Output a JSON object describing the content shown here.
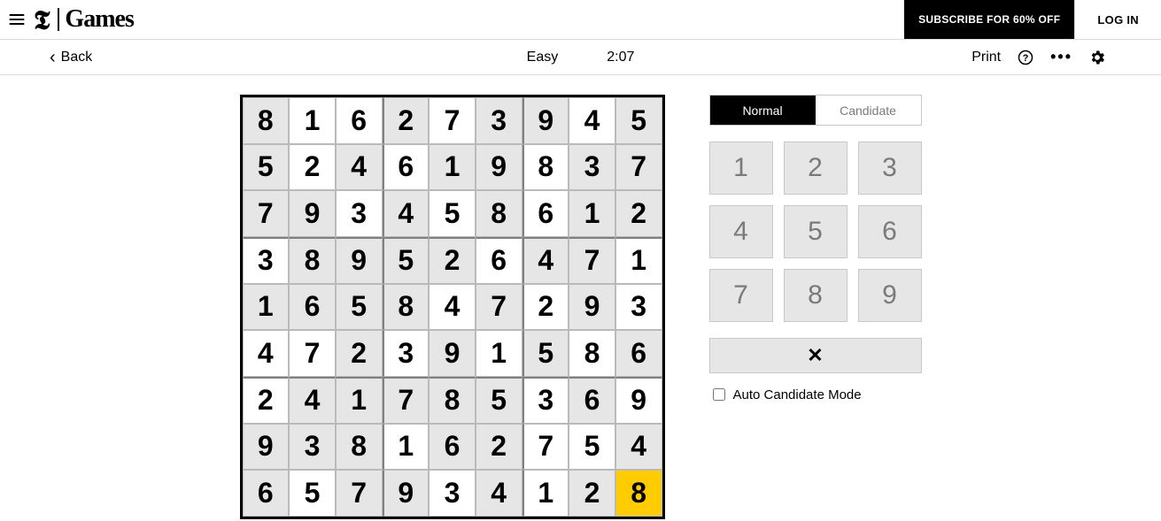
{
  "header": {
    "logo_text": "Games",
    "subscribe_label": "SUBSCRIBE FOR 60% OFF",
    "login_label": "LOG IN"
  },
  "toolbar": {
    "back_label": "Back",
    "difficulty": "Easy",
    "timer": "2:07",
    "print_label": "Print"
  },
  "modes": {
    "normal": "Normal",
    "candidate": "Candidate"
  },
  "keypad": [
    "1",
    "2",
    "3",
    "4",
    "5",
    "6",
    "7",
    "8",
    "9"
  ],
  "erase_symbol": "✕",
  "auto_label": "Auto Candidate Mode",
  "sudoku": {
    "selected": [
      8,
      8
    ],
    "grid": [
      [
        {
          "v": "8",
          "g": true
        },
        {
          "v": "1",
          "g": false
        },
        {
          "v": "6",
          "g": false
        },
        {
          "v": "2",
          "g": true
        },
        {
          "v": "7",
          "g": false
        },
        {
          "v": "3",
          "g": true
        },
        {
          "v": "9",
          "g": true
        },
        {
          "v": "4",
          "g": false
        },
        {
          "v": "5",
          "g": true
        }
      ],
      [
        {
          "v": "5",
          "g": true
        },
        {
          "v": "2",
          "g": false
        },
        {
          "v": "4",
          "g": true
        },
        {
          "v": "6",
          "g": false
        },
        {
          "v": "1",
          "g": true
        },
        {
          "v": "9",
          "g": true
        },
        {
          "v": "8",
          "g": false
        },
        {
          "v": "3",
          "g": true
        },
        {
          "v": "7",
          "g": true
        }
      ],
      [
        {
          "v": "7",
          "g": true
        },
        {
          "v": "9",
          "g": true
        },
        {
          "v": "3",
          "g": false
        },
        {
          "v": "4",
          "g": true
        },
        {
          "v": "5",
          "g": false
        },
        {
          "v": "8",
          "g": true
        },
        {
          "v": "6",
          "g": false
        },
        {
          "v": "1",
          "g": true
        },
        {
          "v": "2",
          "g": true
        }
      ],
      [
        {
          "v": "3",
          "g": false
        },
        {
          "v": "8",
          "g": true
        },
        {
          "v": "9",
          "g": true
        },
        {
          "v": "5",
          "g": true
        },
        {
          "v": "2",
          "g": true
        },
        {
          "v": "6",
          "g": false
        },
        {
          "v": "4",
          "g": true
        },
        {
          "v": "7",
          "g": true
        },
        {
          "v": "1",
          "g": false
        }
      ],
      [
        {
          "v": "1",
          "g": true
        },
        {
          "v": "6",
          "g": true
        },
        {
          "v": "5",
          "g": true
        },
        {
          "v": "8",
          "g": true
        },
        {
          "v": "4",
          "g": false
        },
        {
          "v": "7",
          "g": true
        },
        {
          "v": "2",
          "g": false
        },
        {
          "v": "9",
          "g": true
        },
        {
          "v": "3",
          "g": false
        }
      ],
      [
        {
          "v": "4",
          "g": false
        },
        {
          "v": "7",
          "g": false
        },
        {
          "v": "2",
          "g": true
        },
        {
          "v": "3",
          "g": false
        },
        {
          "v": "9",
          "g": true
        },
        {
          "v": "1",
          "g": false
        },
        {
          "v": "5",
          "g": true
        },
        {
          "v": "8",
          "g": false
        },
        {
          "v": "6",
          "g": true
        }
      ],
      [
        {
          "v": "2",
          "g": false
        },
        {
          "v": "4",
          "g": true
        },
        {
          "v": "1",
          "g": true
        },
        {
          "v": "7",
          "g": true
        },
        {
          "v": "8",
          "g": true
        },
        {
          "v": "5",
          "g": true
        },
        {
          "v": "3",
          "g": false
        },
        {
          "v": "6",
          "g": true
        },
        {
          "v": "9",
          "g": false
        }
      ],
      [
        {
          "v": "9",
          "g": true
        },
        {
          "v": "3",
          "g": true
        },
        {
          "v": "8",
          "g": true
        },
        {
          "v": "1",
          "g": false
        },
        {
          "v": "6",
          "g": true
        },
        {
          "v": "2",
          "g": true
        },
        {
          "v": "7",
          "g": false
        },
        {
          "v": "5",
          "g": false
        },
        {
          "v": "4",
          "g": true
        }
      ],
      [
        {
          "v": "6",
          "g": true
        },
        {
          "v": "5",
          "g": false
        },
        {
          "v": "7",
          "g": true
        },
        {
          "v": "9",
          "g": true
        },
        {
          "v": "3",
          "g": false
        },
        {
          "v": "4",
          "g": true
        },
        {
          "v": "1",
          "g": false
        },
        {
          "v": "2",
          "g": true
        },
        {
          "v": "8",
          "g": false
        }
      ]
    ]
  }
}
